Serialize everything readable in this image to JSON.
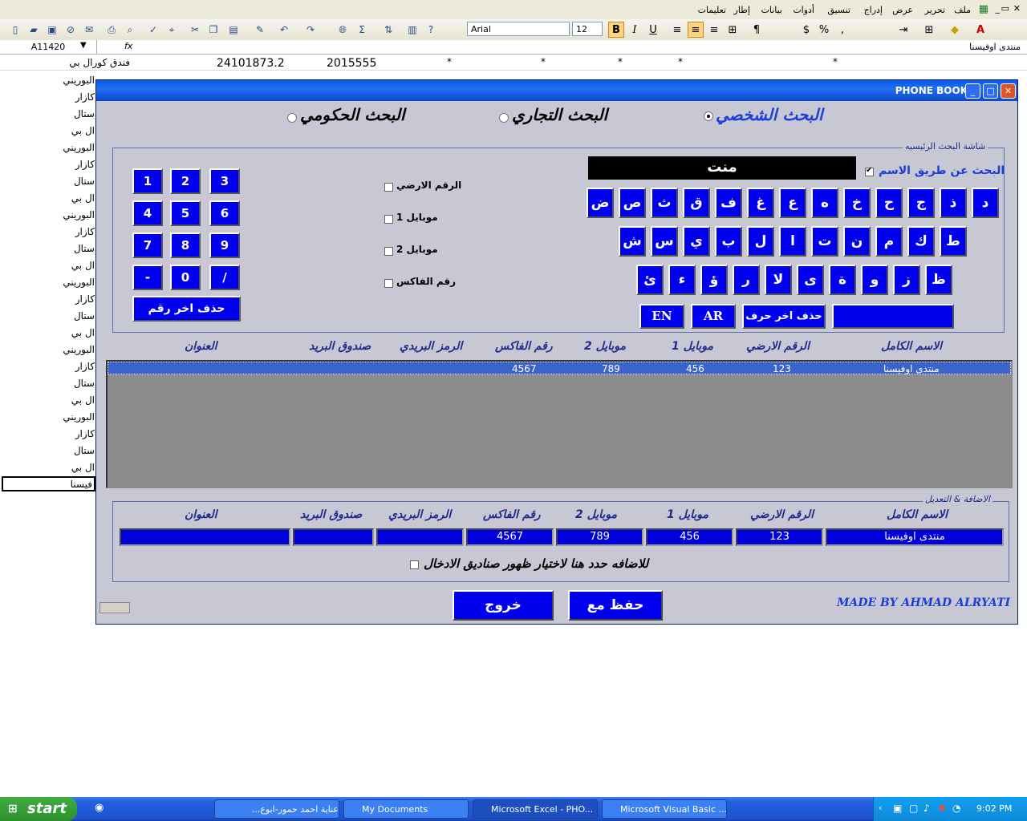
{
  "excel": {
    "menu": [
      "ملف",
      "تحرير",
      "عرض",
      "إدراج",
      "تنسيق",
      "أدوات",
      "بيانات",
      "إطار",
      "تعليمات"
    ],
    "font_name": "Arial",
    "font_size": "12",
    "name_box": "A11420",
    "fx": "fx",
    "formula_value": "منتدى اوفيسنا",
    "row_top": {
      "name": "فندق كورال بي",
      "num1": "24101873.2",
      "num2": "2015555"
    },
    "sheet_cells": [
      "البوريني",
      "كازار",
      "ستال",
      "ال بي",
      "البوريني",
      "كازار",
      "ستال",
      "ال بي",
      "البوريني",
      "كازار",
      "ستال",
      "ال بي",
      "البوريني",
      "كازار",
      "ستال",
      "ال بي",
      "البوريني",
      "كازار",
      "ستال",
      "ال بي",
      "البوريني",
      "كازار",
      "ستال",
      "ال بي",
      "فيسنا"
    ],
    "star": "*"
  },
  "window": {
    "title": "PHONE BOOK",
    "radios": [
      {
        "label": "البحث الشخصي",
        "selected": true
      },
      {
        "label": "البحث التجاري",
        "selected": false
      },
      {
        "label": "البحث الحكومي",
        "selected": false
      }
    ],
    "search_frame_title": "شاشة البحث الرئيسيه",
    "search_by_name_label": "البحث عن طريق الاسم",
    "search_by_name_checked": true,
    "search_text": "منت",
    "checks": [
      "الرقم الارضي",
      "موبايل 1",
      "موبايل 2",
      "رقم الفاكس"
    ],
    "numpad": [
      "1",
      "2",
      "3",
      "4",
      "5",
      "6",
      "7",
      "8",
      "9",
      "-",
      "0",
      "/"
    ],
    "delete_digit": "حذف اخر رقم",
    "letters_row1": [
      "د",
      "ذ",
      "ج",
      "ح",
      "خ",
      "ه",
      "ع",
      "غ",
      "ف",
      "ق",
      "ث",
      "ص",
      "ض"
    ],
    "letters_row2": [
      "ط",
      "ك",
      "م",
      "ن",
      "ت",
      "ا",
      "ل",
      "ب",
      "ي",
      "س",
      "ش"
    ],
    "letters_row3": [
      "ظ",
      "ز",
      "و",
      "ة",
      "ى",
      "لا",
      "ر",
      "ؤ",
      "ء",
      "ئ"
    ],
    "lang_en": "EN",
    "lang_ar": "AR",
    "delete_letter": "حذف اخر حرف",
    "columns": [
      "الاسم الكامل",
      "الرقم الارضي",
      "موبايل 1",
      "موبايل 2",
      "رقم الفاكس",
      "الرمز البريدي",
      "صندوق البريد",
      "العنوان"
    ],
    "result_row": {
      "name": "منتدى اوفيسنا",
      "land": "123",
      "mob1": "456",
      "mob2": "789",
      "fax": "4567"
    },
    "edit_frame_title": "الاضافة & التعديل",
    "edit_values": {
      "name": "منتدى اوفيسنا",
      "land": "123",
      "mob1": "456",
      "mob2": "789",
      "fax": "4567",
      "zip": "",
      "pobox": "",
      "address": ""
    },
    "add_hint": "للاضافه حدد هنا لاختيار ظهور صناديق الادخال",
    "save_exit": "حفظ مع خروج",
    "exit": "خروج",
    "credit": "MADE BY AHMAD ALRYATI",
    "controls": {
      "minimize": "_",
      "maximize": "□",
      "close": "✕"
    }
  },
  "taskbar": {
    "start": "start",
    "tasks": [
      "عناية احمد حمور-ابوع...",
      "My Documents",
      "Microsoft Excel - PHO...",
      "Microsoft Visual Basic ..."
    ],
    "clock": "9:02 PM"
  },
  "colors": {
    "accent": "#0000ee",
    "titlebar": "#0a58e8",
    "form_bg": "#c8c8d4"
  }
}
